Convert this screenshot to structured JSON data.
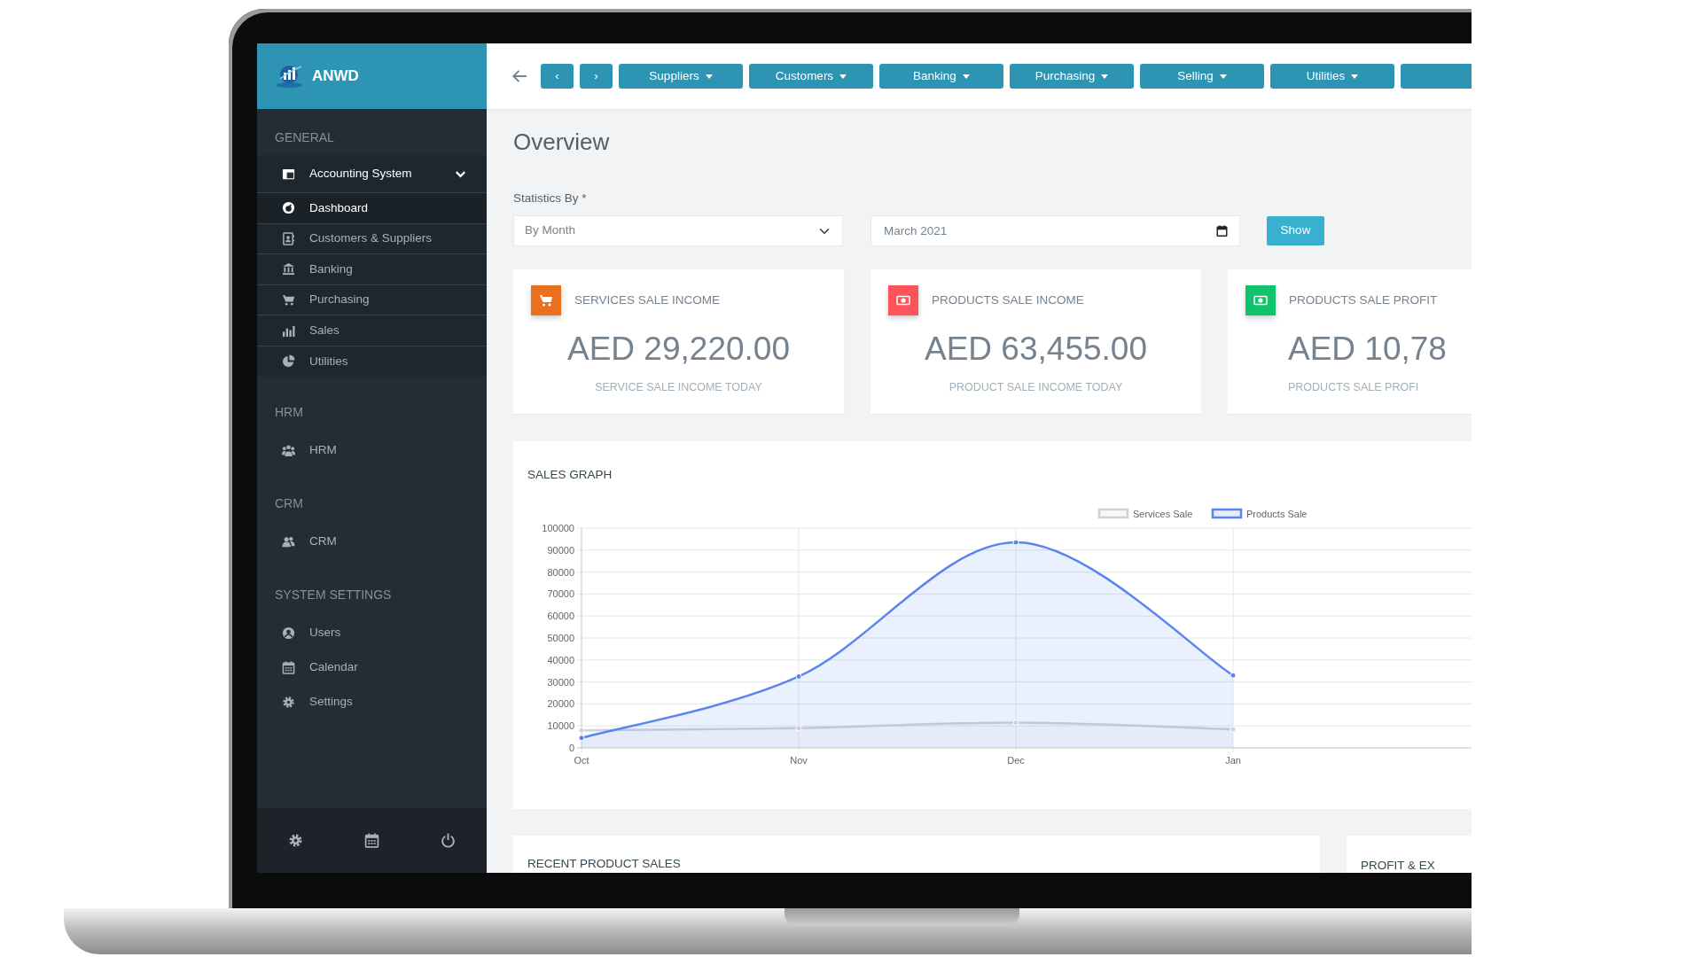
{
  "sidebar": {
    "logo_text": "ANWD",
    "sections": [
      {
        "title": "GENERAL",
        "items": [
          {
            "label": "Accounting System",
            "selected": false,
            "expanded": true,
            "children": [
              {
                "label": "Dashboard",
                "selected": true
              },
              {
                "label": "Customers & Suppliers",
                "selected": false
              },
              {
                "label": "Banking",
                "selected": false
              },
              {
                "label": "Purchasing",
                "selected": false
              },
              {
                "label": "Sales",
                "selected": false
              },
              {
                "label": "Utilities",
                "selected": false
              }
            ]
          }
        ]
      },
      {
        "title": "HRM",
        "items": [
          {
            "label": "HRM",
            "selected": false
          }
        ]
      },
      {
        "title": "CRM",
        "items": [
          {
            "label": "CRM",
            "selected": false
          }
        ]
      },
      {
        "title": "SYSTEM SETTINGS",
        "items": [
          {
            "label": "Users",
            "selected": false
          },
          {
            "label": "Calendar",
            "selected": false
          },
          {
            "label": "Settings",
            "selected": false
          }
        ]
      }
    ]
  },
  "toolbar": {
    "buttons": [
      {
        "label": "‹",
        "kind": "arrow"
      },
      {
        "label": "›",
        "kind": "arrow"
      },
      {
        "label": "Suppliers",
        "kind": "dropdown"
      },
      {
        "label": "Customers",
        "kind": "dropdown"
      },
      {
        "label": "Banking",
        "kind": "dropdown"
      },
      {
        "label": "Purchasing",
        "kind": "dropdown"
      },
      {
        "label": "Selling",
        "kind": "dropdown"
      },
      {
        "label": "Utilities",
        "kind": "dropdown"
      }
    ],
    "overflow_button": true
  },
  "page_title": "Overview",
  "filters": {
    "label": "Statistics By *",
    "period": {
      "value": "By Month"
    },
    "date": {
      "value": "March 2021"
    },
    "button": "Show"
  },
  "stat_cards": [
    {
      "title": "SERVICES SALE INCOME",
      "value": "AED 29,220.00",
      "caption": "SERVICE SALE INCOME TODAY",
      "color": "#e8711f"
    },
    {
      "title": "PRODUCTS SALE INCOME",
      "value": "AED 63,455.00",
      "caption": "PRODUCT SALE INCOME TODAY",
      "color": "#fc5458"
    },
    {
      "title": "PRODUCTS SALE PROFIT",
      "value": "AED 10,78",
      "caption": "PRODUCTS SALE PROFI",
      "color": "#11c26d"
    }
  ],
  "sales_graph": {
    "title": "SALES GRAPH",
    "chart_data": {
      "type": "area",
      "categories": [
        "Oct",
        "Nov",
        "Dec",
        "Jan"
      ],
      "series": [
        {
          "name": "Services Sale",
          "color": "#cdd2d8",
          "values": [
            8000,
            9000,
            11500,
            8500
          ]
        },
        {
          "name": "Products Sale",
          "color": "#5b84f0",
          "values": [
            4500,
            32500,
            93500,
            33000
          ]
        }
      ],
      "legend": true,
      "grid": true,
      "ylim": [
        0,
        100000
      ],
      "yticks": [
        0,
        10000,
        20000,
        30000,
        40000,
        50000,
        60000,
        70000,
        80000,
        90000,
        100000
      ]
    }
  },
  "bottom_panels": [
    {
      "title": "RECENT PRODUCT SALES"
    },
    {
      "title": "PROFIT & EX"
    }
  ]
}
